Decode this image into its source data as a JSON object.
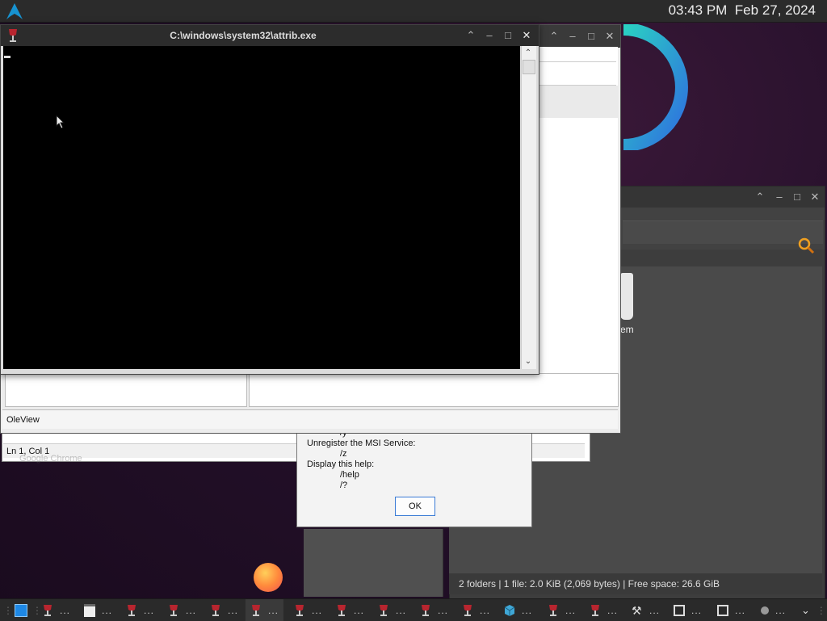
{
  "top_panel": {
    "time": "03:43 PM",
    "date": "Feb 27, 2024"
  },
  "console_window": {
    "title": "C:\\windows\\system32\\attrib.exe"
  },
  "oleview_window": {
    "status": "OleView"
  },
  "notepad_window": {
    "status": "Ln 1, Col 1",
    "background_text": "Google Chrome"
  },
  "msi_dialog": {
    "lines": [
      {
        "indent": true,
        "text": "/y"
      },
      {
        "indent": false,
        "text": "Unregister the MSI Service:"
      },
      {
        "indent": true,
        "text": "/z"
      },
      {
        "indent": false,
        "text": "Display this help:"
      },
      {
        "indent": true,
        "text": "/help"
      },
      {
        "indent": true,
        "text": "/?"
      }
    ],
    "ok_label": "OK"
  },
  "file_manager": {
    "file_label_partial": "em",
    "status": "2 folders  |  1 file: 2.0 KiB (2,069 bytes)  |  Free space: 26.6 GiB"
  },
  "taskbar": {
    "more_label": "...",
    "items": [
      "app-icon",
      "wine-icon",
      "notepad-icon",
      "wine-icon",
      "wine-icon",
      "wine-icon",
      "wine-icon",
      "wine-icon",
      "wine-icon",
      "wine-icon",
      "wine-icon",
      "wine-icon",
      "cube-icon",
      "wine-icon",
      "wine-icon",
      "tools-icon",
      "window-icon",
      "window-icon",
      "circle-icon"
    ]
  },
  "colors": {
    "accent_blue": "#3a7bd5",
    "ring_gradient_start": "#2f8fe0",
    "ring_gradient_end": "#2ad1c2",
    "wine_red": "#b8252f"
  }
}
